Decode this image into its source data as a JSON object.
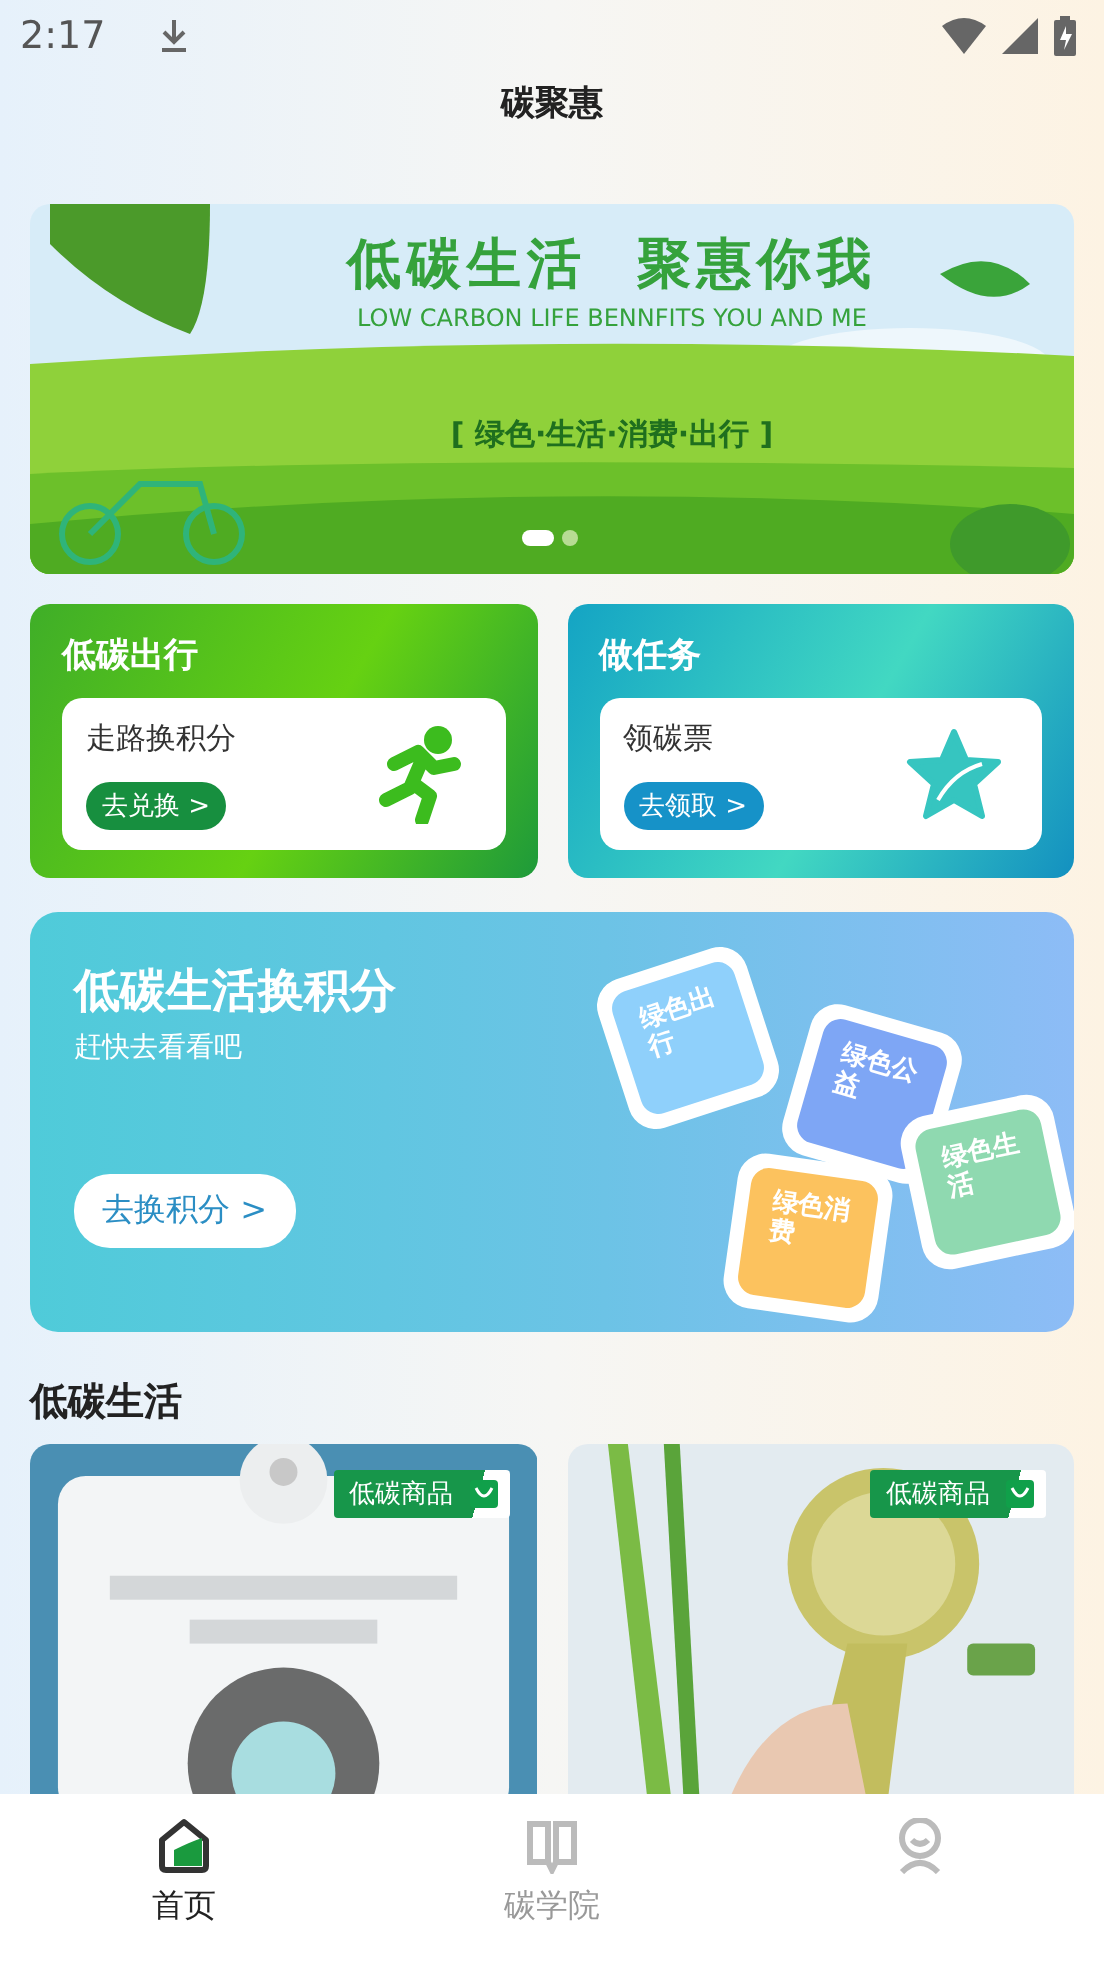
{
  "status_bar": {
    "time": "2:17"
  },
  "header": {
    "title": "碳聚惠"
  },
  "banner": {
    "headline": "低碳生活  聚惠你我",
    "subtitle": "LOW CARBON LIFE BENNFITS YOU AND ME",
    "slogan": "[ 绿色·生活·消费·出行 ]",
    "dots": [
      {
        "selected": true
      },
      {
        "selected": false
      }
    ]
  },
  "actions": [
    {
      "kind": "walk",
      "title": "低碳出行",
      "label": "走路换积分",
      "button": "去兑换 >"
    },
    {
      "kind": "task",
      "title": "做任务",
      "label": "领碳票",
      "button": "去领取 >"
    }
  ],
  "promo": {
    "title": "低碳生活换积分",
    "subtitle": "赶快去看看吧",
    "button": "去换积分 >",
    "tiles": [
      {
        "label": "绿色出行",
        "color": "#8fd0fb"
      },
      {
        "label": "绿色公益",
        "color": "#7ea6f5"
      },
      {
        "label": "绿色消费",
        "color": "#fcc25e"
      },
      {
        "label": "绿色生活",
        "color": "#8fd9b0"
      }
    ]
  },
  "section": {
    "title": "低碳生活"
  },
  "products": [
    {
      "tag": "低碳商品"
    },
    {
      "tag": "低碳商品"
    }
  ],
  "nav": [
    {
      "kind": "home",
      "label": "首页",
      "selected": true
    },
    {
      "kind": "book",
      "label": "碳学院",
      "selected": false
    },
    {
      "kind": "person",
      "selected": false
    }
  ]
}
